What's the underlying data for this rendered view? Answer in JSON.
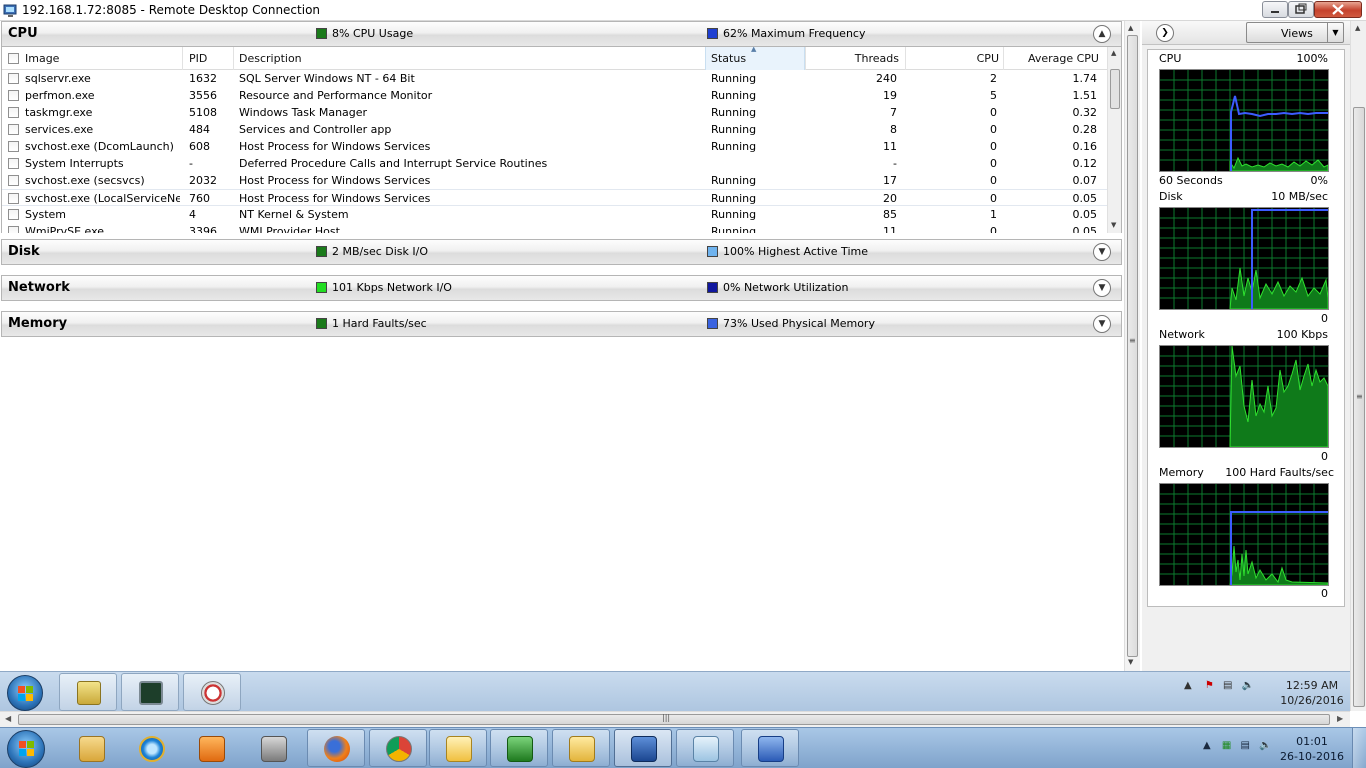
{
  "window": {
    "title": "192.168.1.72:8085 - Remote Desktop Connection"
  },
  "cpu": {
    "title": "CPU",
    "stat_left": "8% CPU Usage",
    "stat_right": "62% Maximum Frequency",
    "stat_left_color": "#1a7a1a",
    "stat_right_color": "#1f3fd0",
    "columns": {
      "image": "Image",
      "pid": "PID",
      "description": "Description",
      "status": "Status",
      "threads": "Threads",
      "cpu": "CPU",
      "average_cpu": "Average CPU"
    },
    "rows": [
      {
        "image": "sqlservr.exe",
        "pid": "1632",
        "description": "SQL Server Windows NT - 64 Bit",
        "status": "Running",
        "threads": "240",
        "cpu": "2",
        "avg": "1.74"
      },
      {
        "image": "perfmon.exe",
        "pid": "3556",
        "description": "Resource and Performance Monitor",
        "status": "Running",
        "threads": "19",
        "cpu": "5",
        "avg": "1.51"
      },
      {
        "image": "taskmgr.exe",
        "pid": "5108",
        "description": "Windows Task Manager",
        "status": "Running",
        "threads": "7",
        "cpu": "0",
        "avg": "0.32"
      },
      {
        "image": "services.exe",
        "pid": "484",
        "description": "Services and Controller app",
        "status": "Running",
        "threads": "8",
        "cpu": "0",
        "avg": "0.28"
      },
      {
        "image": "svchost.exe (DcomLaunch)",
        "pid": "608",
        "description": "Host Process for Windows Services",
        "status": "Running",
        "threads": "11",
        "cpu": "0",
        "avg": "0.16"
      },
      {
        "image": "System Interrupts",
        "pid": "-",
        "description": "Deferred Procedure Calls and Interrupt Service Routines",
        "status": "",
        "threads": "-",
        "cpu": "0",
        "avg": "0.12"
      },
      {
        "image": "svchost.exe (secsvcs)",
        "pid": "2032",
        "description": "Host Process for Windows Services",
        "status": "Running",
        "threads": "17",
        "cpu": "0",
        "avg": "0.07"
      },
      {
        "image": "svchost.exe (LocalServiceNet...",
        "pid": "760",
        "description": "Host Process for Windows Services",
        "status": "Running",
        "threads": "20",
        "cpu": "0",
        "avg": "0.05"
      },
      {
        "image": "System",
        "pid": "4",
        "description": "NT Kernel & System",
        "status": "Running",
        "threads": "85",
        "cpu": "1",
        "avg": "0.05"
      },
      {
        "image": "WmiPrvSE.exe",
        "pid": "3396",
        "description": "WMI Provider Host",
        "status": "Running",
        "threads": "11",
        "cpu": "0",
        "avg": "0.05"
      }
    ]
  },
  "disk": {
    "title": "Disk",
    "stat_left": "2 MB/sec Disk I/O",
    "stat_right": "100% Highest Active Time",
    "stat_left_color": "#1a7a1a",
    "stat_right_color": "#6fb3ee"
  },
  "network": {
    "title": "Network",
    "stat_left": "101 Kbps Network I/O",
    "stat_right": "0% Network Utilization",
    "stat_left_color": "#22dd22",
    "stat_right_color": "#10179e"
  },
  "memory": {
    "title": "Memory",
    "stat_left": "1 Hard Faults/sec",
    "stat_right": "73% Used Physical Memory",
    "stat_left_color": "#1a7a1a",
    "stat_right_color": "#3a63e0"
  },
  "graphs": {
    "views_label": "Views",
    "cpu": {
      "label": "CPU",
      "max": "100%",
      "bottom_left": "60 Seconds",
      "bottom_right": "0%"
    },
    "disk": {
      "label": "Disk",
      "max": "10 MB/sec",
      "bottom_right": "0"
    },
    "network": {
      "label": "Network",
      "max": "100 Kbps",
      "bottom_right": "0"
    },
    "memory": {
      "label": "Memory",
      "max": "100 Hard Faults/sec",
      "bottom_right": "0"
    },
    "grid_color": "#0d7a2e",
    "line_green": "#2fe02f",
    "line_blue": "#3c5cff"
  },
  "remote_taskbar": {
    "time": "12:59 AM",
    "date": "10/26/2016",
    "tasks": [
      "server-manager-icon",
      "resource-monitor-icon",
      "performance-monitor-icon"
    ]
  },
  "local_taskbar": {
    "time": "01:01",
    "date": "26-10-2016",
    "tasks": [
      "outlook-mail-icon",
      "internet-explorer-icon",
      "media-player-icon",
      "remote-admin-icon",
      "firefox-icon",
      "chrome-icon",
      "outlook-calendar-icon",
      "excel-icon",
      "file-explorer-icon",
      "remote-desktop-icon",
      "notepad-icon",
      "word-icon"
    ]
  }
}
